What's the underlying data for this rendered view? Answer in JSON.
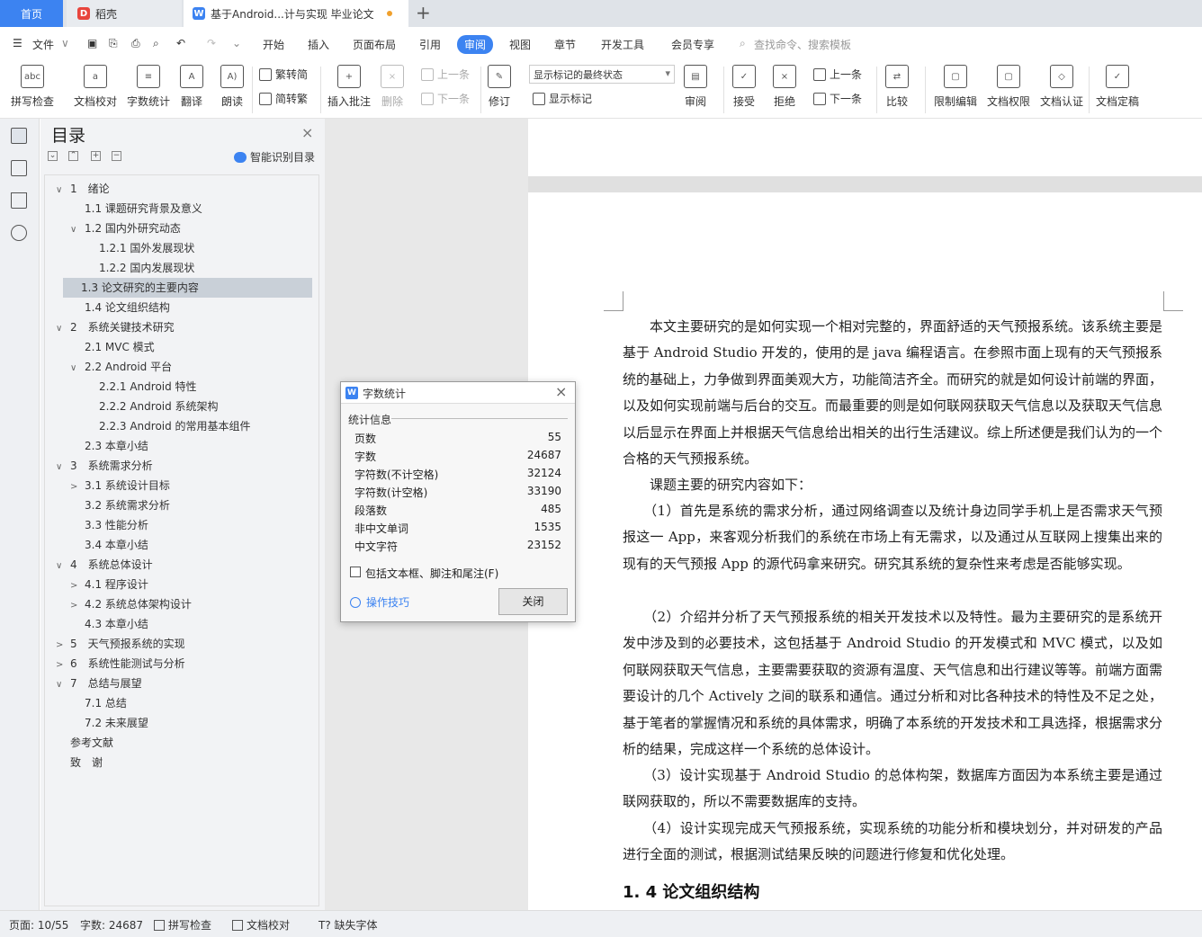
{
  "tabs": {
    "home": "首页",
    "daoke": "稻壳",
    "doc": "基于Android...计与实现 毕业论文",
    "add": "+"
  },
  "menu": {
    "file": "文件",
    "items": [
      "开始",
      "插入",
      "页面布局",
      "引用",
      "审阅",
      "视图",
      "章节",
      "开发工具",
      "会员专享"
    ],
    "search": "查找命令、搜索模板"
  },
  "ribbon": {
    "spellcheck": "拼写检查",
    "proofread": "文档校对",
    "wordcount": "字数统计",
    "translate": "翻译",
    "read_aloud": "朗读",
    "trad": "繁转简",
    "simp": "简转繁",
    "insert_comment": "插入批注",
    "delete": "删除",
    "prev_comment": "上一条",
    "next_comment": "下一条",
    "revise": "修订",
    "track_state": "显示标记的最终状态",
    "show_markup": "显示标记",
    "review": "审阅",
    "accept": "接受",
    "reject": "拒绝",
    "prev": "上一条",
    "next": "下一条",
    "compare": "比较",
    "restrict": "限制编辑",
    "doc_rights": "文档权限",
    "doc_cert": "文档认证",
    "doc_final": "文档定稿"
  },
  "toc": {
    "title": "目录",
    "smart": "智能识别目录",
    "items": [
      {
        "text": "1　绪论",
        "arrow": "∨"
      },
      {
        "text": "1.1 课题研究背景及意义",
        "arrow": ""
      },
      {
        "text": "1.2 国内外研究动态",
        "arrow": "∨"
      },
      {
        "text": "1.2.1 国外发展现状",
        "arrow": ""
      },
      {
        "text": "1.2.2 国内发展现状",
        "arrow": ""
      },
      {
        "text": "1.3 论文研究的主要内容",
        "arrow": ""
      },
      {
        "text": "1.4 论文组织结构",
        "arrow": ""
      },
      {
        "text": "2　系统关键技术研究",
        "arrow": "∨"
      },
      {
        "text": "2.1 MVC 模式",
        "arrow": ""
      },
      {
        "text": "2.2 Android 平台",
        "arrow": "∨"
      },
      {
        "text": "2.2.1 Android 特性",
        "arrow": ""
      },
      {
        "text": "2.2.2 Android 系统架构",
        "arrow": ""
      },
      {
        "text": "2.2.3 Android 的常用基本组件",
        "arrow": ""
      },
      {
        "text": "2.3 本章小结",
        "arrow": ""
      },
      {
        "text": "3　系统需求分析",
        "arrow": "∨"
      },
      {
        "text": "3.1 系统设计目标",
        "arrow": ">"
      },
      {
        "text": "3.2 系统需求分析",
        "arrow": ""
      },
      {
        "text": "3.3 性能分析",
        "arrow": ""
      },
      {
        "text": "3.4 本章小结",
        "arrow": ""
      },
      {
        "text": "4　系统总体设计",
        "arrow": "∨"
      },
      {
        "text": "4.1 程序设计",
        "arrow": ">"
      },
      {
        "text": "4.2 系统总体架构设计",
        "arrow": ">"
      },
      {
        "text": "4.3 本章小结",
        "arrow": ""
      },
      {
        "text": "5　天气预报系统的实现",
        "arrow": ">"
      },
      {
        "text": "6　系统性能测试与分析",
        "arrow": ">"
      },
      {
        "text": "7　总结与展望",
        "arrow": "∨"
      },
      {
        "text": "7.1 总结",
        "arrow": ""
      },
      {
        "text": "7.2 未来展望",
        "arrow": ""
      },
      {
        "text": "参考文献",
        "arrow": ""
      },
      {
        "text": "致　谢",
        "arrow": ""
      }
    ]
  },
  "document": {
    "paragraphs": [
      "　　本文主要研究的是如何实现一个相对完整的，界面舒适的天气预报系统。该系统主要是基于 Android Studio 开发的，使用的是 java 编程语言。在参照市面上现有的天气预报系统的基础上，力争做到界面美观大方，功能简洁齐全。而研究的就是如何设计前端的界面，以及如何实现前端与后台的交互。而最重要的则是如何联网获取天气信息以及获取天气信息以后显示在界面上并根据天气信息给出相关的出行生活建议。综上所述便是我们认为的一个合格的天气预报系统。",
      "　　课题主要的研究内容如下：",
      "　　（1）首先是系统的需求分析，通过网络调查以及统计身边同学手机上是否需求天气预报这一 App，来客观分析我们的系统在市场上有无需求，以及通过从互联网上搜集出来的现有的天气预报 App 的源代码拿来研究。研究其系统的复杂性来考虑是否能够实现。",
      "　　（2）介绍并分析了天气预报系统的相关开发技术以及特性。最为主要研究的是系统开发中涉及到的必要技术，这包括基于 Android Studio 的开发模式和 MVC 模式，以及如何联网获取天气信息，主要需要获取的资源有温度、天气信息和出行建议等等。前端方面需要设计的几个 Actively 之间的联系和通信。通过分析和对比各种技术的特性及不足之处，基于笔者的掌握情况和系统的具体需求，明确了本系统的开发技术和工具选择，根据需求分析的结果，完成这样一个系统的总体设计。",
      "　　（3）设计实现基于 Android Studio 的总体构架，数据库方面因为本系统主要是通过联网获取的，所以不需要数据库的支持。",
      "　　（4）设计实现完成天气预报系统，实现系统的功能分析和模块划分，并对研发的产品进行全面的测试，根据测试结果反映的问题进行修复和优化处理。"
    ],
    "heading": "1. 4 论文组织结构"
  },
  "dialog": {
    "title": "字数统计",
    "section": "统计信息",
    "stats": [
      {
        "label": "页数",
        "value": "55"
      },
      {
        "label": "字数",
        "value": "24687"
      },
      {
        "label": "字符数(不计空格)",
        "value": "32124"
      },
      {
        "label": "字符数(计空格)",
        "value": "33190"
      },
      {
        "label": "段落数",
        "value": "485"
      },
      {
        "label": "非中文单词",
        "value": "1535"
      },
      {
        "label": "中文字符",
        "value": "23152"
      }
    ],
    "checkbox": "包括文本框、脚注和尾注(F)",
    "tips": "操作技巧",
    "close": "关闭"
  },
  "status": {
    "page": "页面: 10/55",
    "words": "字数: 24687",
    "spell": "拼写检查",
    "proof": "文档校对",
    "missing_font": "缺失字体"
  },
  "colors": {
    "accent": "#3c83f1",
    "selected_toc": "#c9d0d8"
  }
}
